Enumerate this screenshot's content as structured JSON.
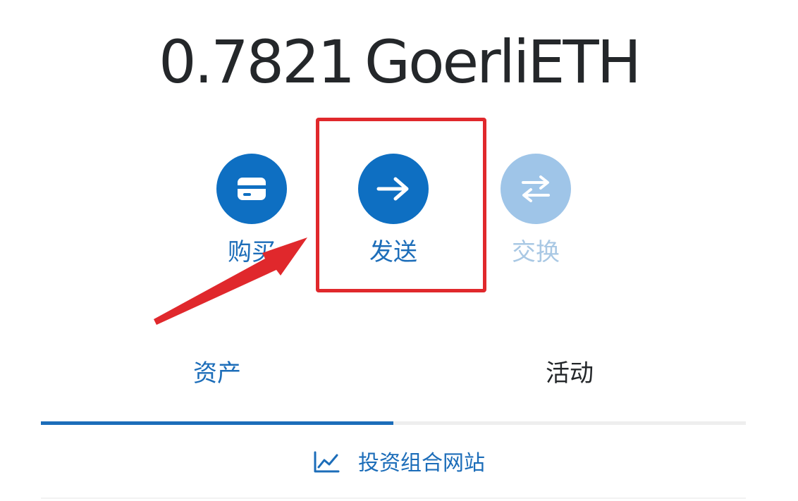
{
  "balance": {
    "amount": "0.7821",
    "unit": "GoerliETH"
  },
  "actions": {
    "buy": {
      "label": "购买",
      "icon": "card-icon"
    },
    "send": {
      "label": "发送",
      "icon": "arrow-right-icon"
    },
    "swap": {
      "label": "交换",
      "icon": "swap-arrows-icon"
    }
  },
  "tabs": [
    {
      "label": "资产",
      "active": true
    },
    {
      "label": "活动",
      "active": false
    }
  ],
  "portfolio": {
    "label": "投资组合网站",
    "icon": "line-chart-icon"
  },
  "colors": {
    "primary": "#0e6fc2",
    "primary_faded": "#9fc5e8",
    "annotation_red": "#e0282c",
    "text_dark": "#24272a"
  }
}
